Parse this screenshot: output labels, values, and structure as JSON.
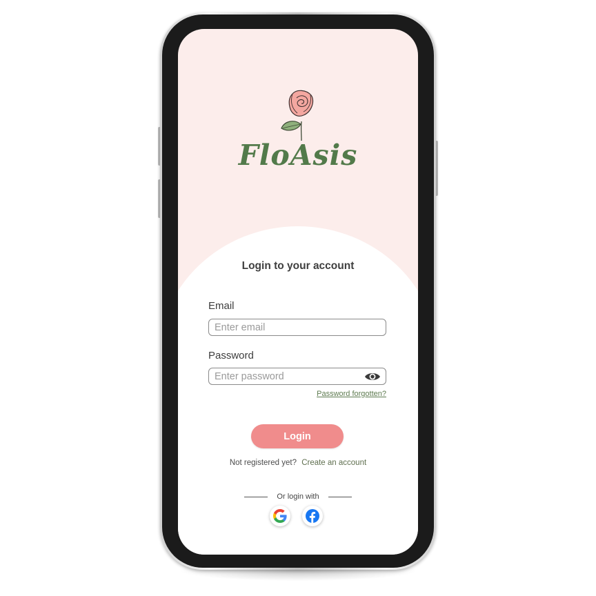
{
  "brand": {
    "logo_text": "FloAsis",
    "primary_color": "#527a4a",
    "accent_color": "#f08c8c",
    "background_color": "#fcedeb"
  },
  "login": {
    "title": "Login to your account",
    "email": {
      "label": "Email",
      "placeholder": "Enter email",
      "value": ""
    },
    "password": {
      "label": "Password",
      "placeholder": "Enter password",
      "value": ""
    },
    "forgot_password": "Password forgotten?",
    "login_button": "Login",
    "register_prompt": "Not registered yet?",
    "create_account": "Create an account",
    "or_login_with": "Or login with",
    "social": [
      {
        "name": "google",
        "icon": "google-icon"
      },
      {
        "name": "facebook",
        "icon": "facebook-icon"
      }
    ]
  },
  "icons": {
    "logo": "rose-flower-icon",
    "password_toggle": "eye-icon"
  }
}
